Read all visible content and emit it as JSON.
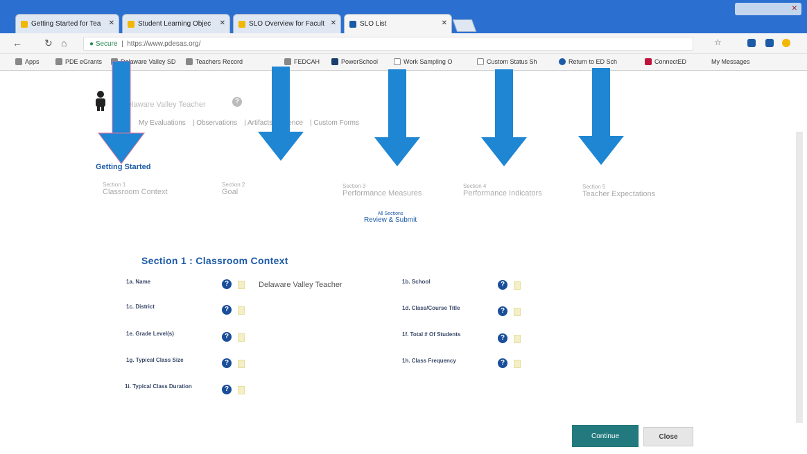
{
  "browser": {
    "tabs": [
      {
        "label": "Getting Started for Tea"
      },
      {
        "label": "Student Learning Objec"
      },
      {
        "label": "SLO Overview for Facult"
      },
      {
        "label": "SLO List"
      }
    ],
    "address": {
      "secure_label": "Secure",
      "url": "https://www.pdesas.org/"
    },
    "bookmarks": [
      {
        "label": "Apps"
      },
      {
        "label": "PDE eGrants"
      },
      {
        "label": "Delaware Valley SD"
      },
      {
        "label": "Teachers Record"
      },
      {
        "label": "FEDCAH"
      },
      {
        "label": "PowerSchool"
      },
      {
        "label": "Work Sampling O"
      },
      {
        "label": "Custom Status Sh"
      },
      {
        "label": "Return to ED Sch"
      },
      {
        "label": "ConnectED"
      },
      {
        "label": "My Messages"
      }
    ]
  },
  "header": {
    "user_name": "Delaware Valley Teacher",
    "help_icon": "?",
    "subnav": [
      "My Evaluations",
      "Observations",
      "Artifacts/Evidence",
      "Custom Forms"
    ]
  },
  "steps": {
    "getting_started": "Getting Started",
    "sections": [
      {
        "number": "Section 1",
        "title": "Classroom Context"
      },
      {
        "number": "Section 2",
        "title": "Goal"
      },
      {
        "number": "Section 3",
        "title": "Performance Measures"
      },
      {
        "number": "Section 4",
        "title": "Performance Indicators"
      },
      {
        "number": "Section 5",
        "title": "Teacher Expectations"
      }
    ],
    "review": {
      "small": "All Sections",
      "label": "Review & Submit"
    }
  },
  "form": {
    "heading": "Section 1 : Classroom Context",
    "left_fields": [
      {
        "label": "1a. Name",
        "value": "Delaware Valley Teacher"
      },
      {
        "label": "1c. District",
        "value": ""
      },
      {
        "label": "1e. Grade Level(s)",
        "value": ""
      },
      {
        "label": "1g. Typical Class Size",
        "value": ""
      },
      {
        "label": "1i. Typical Class Duration",
        "value": ""
      }
    ],
    "right_fields": [
      {
        "label": "1b. School",
        "value": ""
      },
      {
        "label": "1d. Class/Course Title",
        "value": ""
      },
      {
        "label": "1f. Total # Of Students",
        "value": ""
      },
      {
        "label": "1h. Class Frequency",
        "value": ""
      }
    ]
  },
  "buttons": {
    "continue": "Continue",
    "close": "Close"
  },
  "colors": {
    "arrow": "#1f86d3",
    "accent": "#1b5aa6",
    "continue_bg": "#227a7e",
    "help_bg": "#1a4e9a"
  }
}
